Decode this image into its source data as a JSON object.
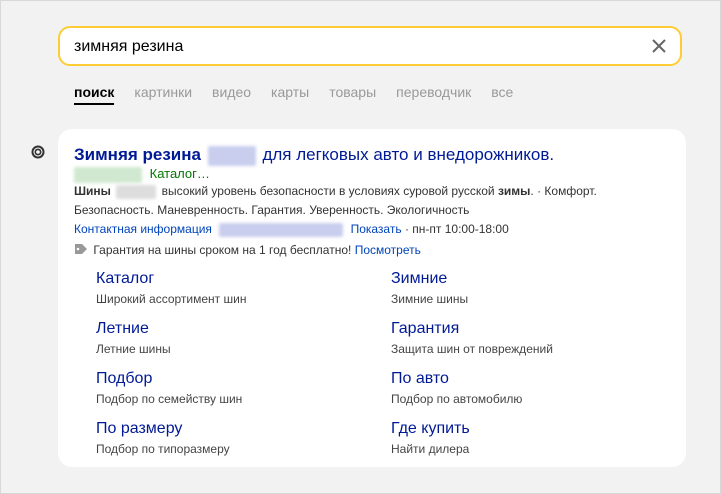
{
  "search": {
    "query": "зимняя резина"
  },
  "tabs": [
    {
      "label": "поиск",
      "active": true
    },
    {
      "label": "картинки"
    },
    {
      "label": "видео"
    },
    {
      "label": "карты"
    },
    {
      "label": "товары"
    },
    {
      "label": "переводчик"
    },
    {
      "label": "все"
    }
  ],
  "result": {
    "title_bold": "Зимняя резина",
    "title_rest": "для легковых авто и внедорожников.",
    "url_text": "Каталог…",
    "snippet_line1_bold1": "Шины",
    "snippet_line1_text": "высокий уровень безопасности в условиях суровой русской",
    "snippet_line1_bold2": "зимы",
    "snippet_line1_tail": ". · Комфорт.",
    "snippet_line2": "Безопасность. Маневренность. Гарантия. Уверенность. Экологичность",
    "contact_label": "Контактная информация",
    "show_label": "Показать",
    "hours": "· пн-пт 10:00-18:00",
    "promo_text": "Гарантия на шины сроком на 1 год бесплатно!",
    "promo_link": "Посмотреть",
    "sitelinks": [
      {
        "title": "Каталог",
        "desc": "Широкий ассортимент шин"
      },
      {
        "title": "Зимние",
        "desc": "Зимние шины"
      },
      {
        "title": "Летние",
        "desc": "Летние шины"
      },
      {
        "title": "Гарантия",
        "desc": "Защита шин от повреждений"
      },
      {
        "title": "Подбор",
        "desc": "Подбор по семейству шин"
      },
      {
        "title": "По авто",
        "desc": "Подбор по автомобилю"
      },
      {
        "title": "По размеру",
        "desc": "Подбор по типоразмеру"
      },
      {
        "title": "Где купить",
        "desc": "Найти дилера"
      }
    ]
  },
  "icons": {
    "clear": "close-icon",
    "favicon": "target-icon",
    "promo": "tag-icon"
  },
  "colors": {
    "search_border": "#ffcc33",
    "link": "#001a96",
    "url": "#007700"
  }
}
